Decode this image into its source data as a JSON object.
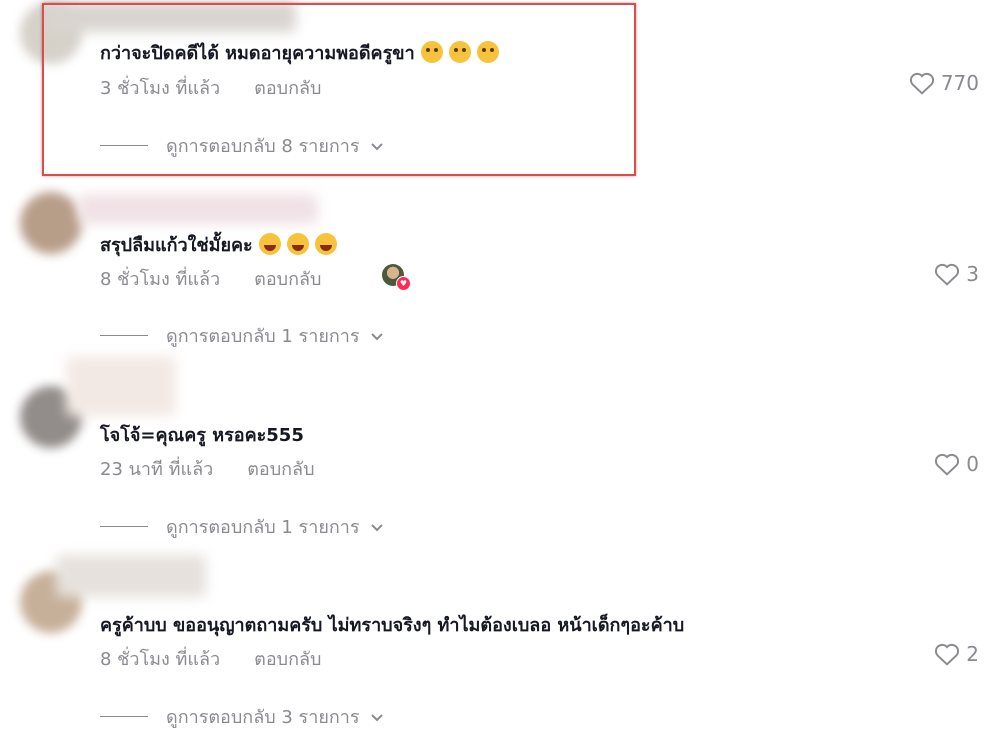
{
  "comments": [
    {
      "text": "กว่าจะปิดคดีได้ หมดอายุความพอดีครูขา",
      "emojis": [
        "kissing-face-icon",
        "kissing-face-icon",
        "kissing-face-icon"
      ],
      "time": "3 ชั่วโมง ที่แล้ว",
      "reply": "ตอบกลับ",
      "likes": "770",
      "view_replies": "ดูการตอบกลับ 8 รายการ",
      "highlighted": true
    },
    {
      "text": "สรุปลืมแก้วใช่มั้ยคะ",
      "emojis": [
        "laughing-face-icon",
        "laughing-face-icon",
        "laughing-face-icon"
      ],
      "time": "8 ชั่วโมง ที่แล้ว",
      "reply": "ตอบกลับ",
      "likes": "3",
      "view_replies": "ดูการตอบกลับ 1 รายการ",
      "creator_liked": true
    },
    {
      "text": "โจโจ้=คุณครู หรอคะ555",
      "emojis": [],
      "time": "23 นาที ที่แล้ว",
      "reply": "ตอบกลับ",
      "likes": "0",
      "view_replies": "ดูการตอบกลับ 1 รายการ"
    },
    {
      "text": "ครูค้าบบ ขออนุญาตถามครับ ไม่ทราบจริงๆ ทำไมต้องเบลอ หน้าเด็กๆอะค้าบ",
      "emojis": [],
      "time": "8 ชั่วโมง ที่แล้ว",
      "reply": "ตอบกลับ",
      "likes": "2",
      "view_replies": "ดูการตอบกลับ 3 รายการ"
    }
  ],
  "colors": {
    "text": "#161823",
    "muted": "#8a8b91",
    "highlight_border": "#e04a4a",
    "like_badge": "#fe2c55"
  }
}
